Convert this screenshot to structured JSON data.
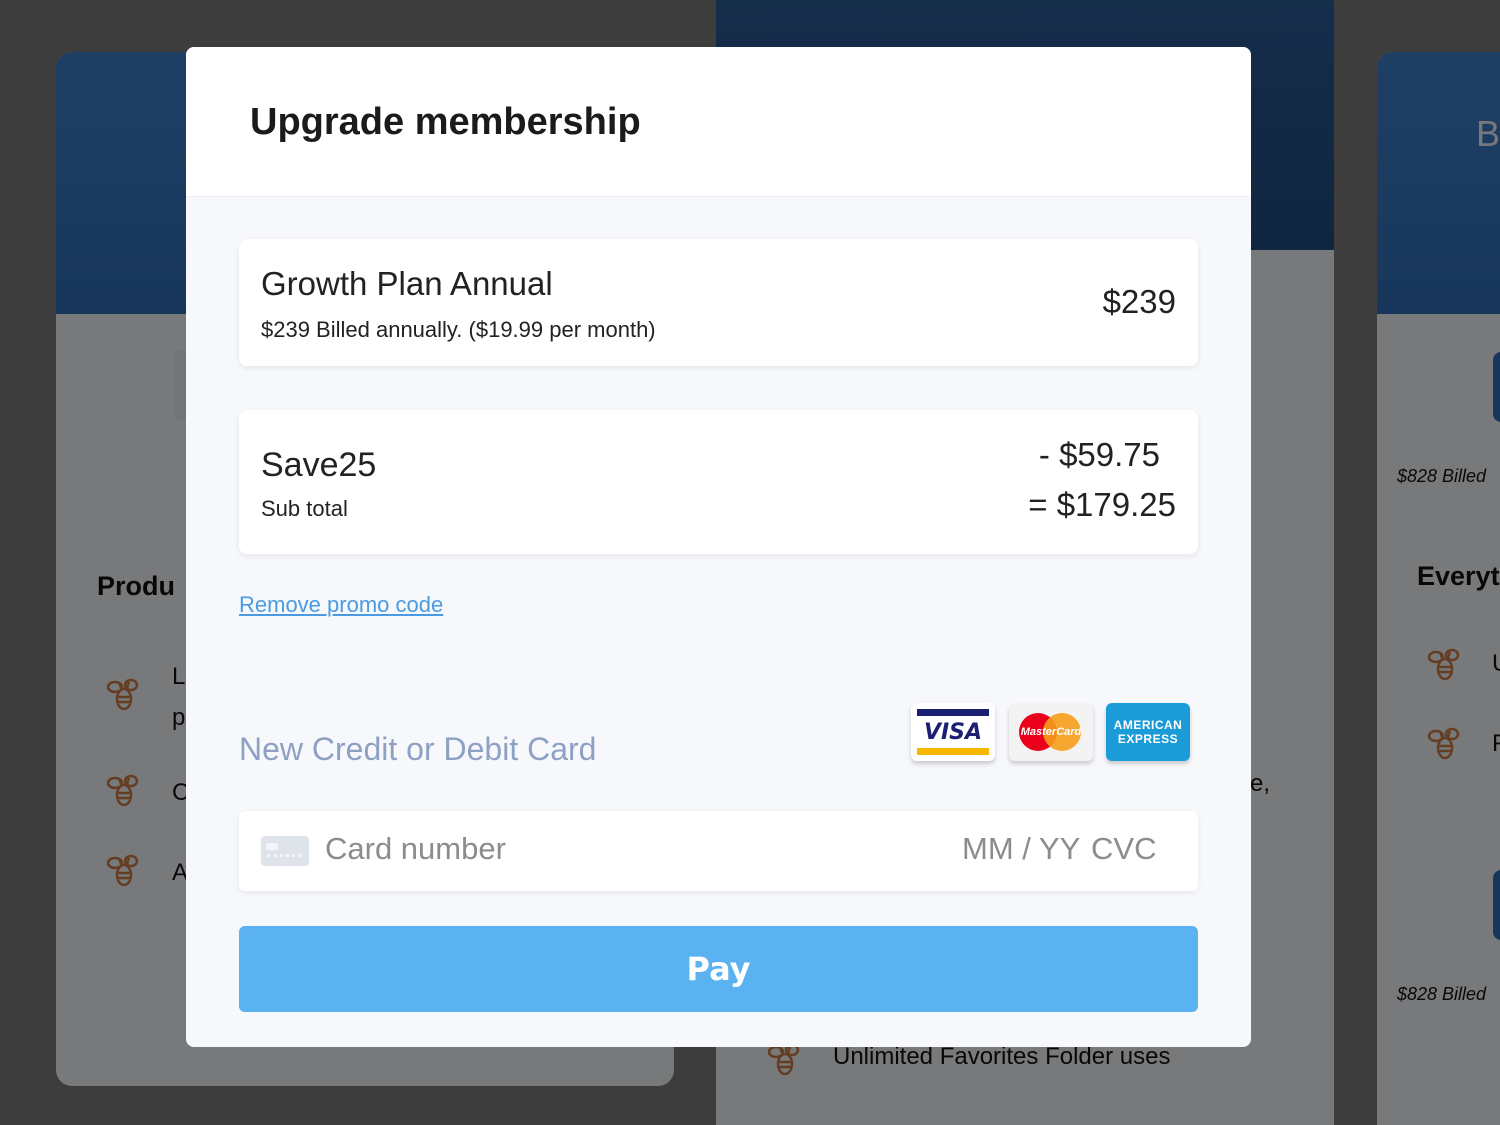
{
  "background": {
    "left_card": {
      "heading": "Produ",
      "features": [
        "L",
        "p",
        "C",
        "A"
      ]
    },
    "middle_card": {
      "feature_tail": "e,",
      "bottom_feature": "Unlimited Favorites Folder uses"
    },
    "right_card": {
      "band_letter": "B",
      "billed_note_1": "$828 Billed",
      "heading": "Everyt",
      "features": [
        "U",
        "F"
      ],
      "billed_note_2": "$828 Billed"
    }
  },
  "modal": {
    "title": "Upgrade membership",
    "plan": {
      "name": "Growth Plan Annual",
      "description": "$239 Billed annually. ($19.99 per month)",
      "price": "$239"
    },
    "promo": {
      "code": "Save25",
      "subtotal_label": "Sub total",
      "discount": "- $59.75",
      "subtotal": "= $179.25"
    },
    "remove_promo_label": "Remove promo code",
    "card_section_title": "New Credit or Debit Card",
    "card_brands": {
      "visa": "VISA",
      "mastercard": "MasterCard",
      "amex_line1": "AMERICAN",
      "amex_line2": "EXPRESS"
    },
    "card_input": {
      "number_placeholder": "Card number",
      "expiry_placeholder": "MM / YY",
      "cvc_placeholder": "CVC"
    },
    "pay_label": "Pay"
  },
  "icons": {
    "feature_icon": "bee-icon",
    "card_icon": "credit-card-icon"
  },
  "colors": {
    "primary": "#5ab2f1",
    "link": "#4a9be2",
    "section_heading": "#8ea1c4",
    "background_band": "#3e7fc9"
  }
}
